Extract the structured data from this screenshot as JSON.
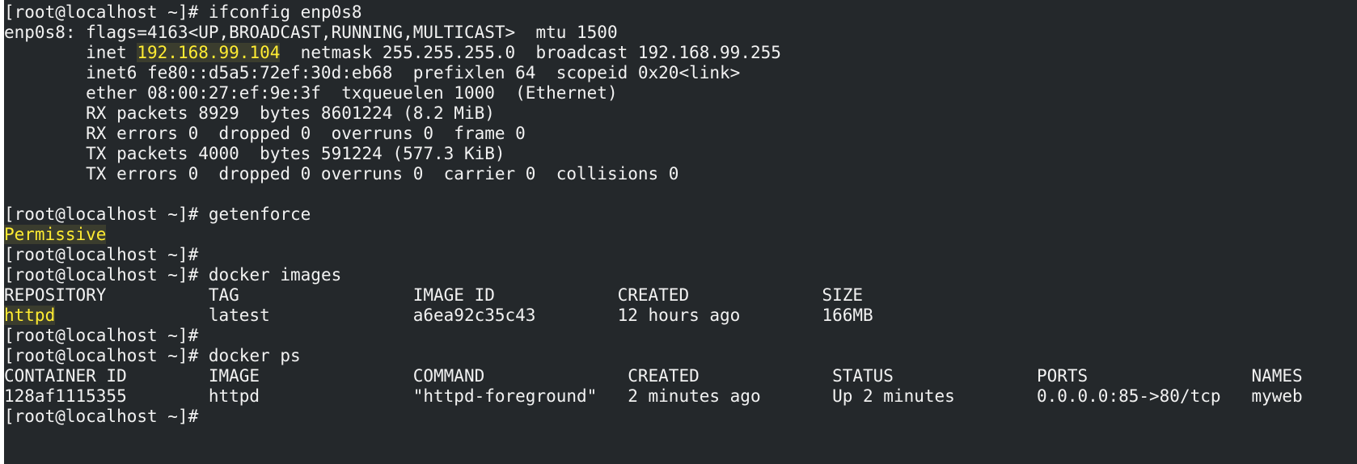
{
  "colors": {
    "background": "#24282b",
    "foreground": "#f2f2f2",
    "highlight": "#ffec32"
  },
  "terminal": {
    "lines": [
      {
        "kind": "prompt",
        "prompt": "[root@localhost ~]# ",
        "command": "ifconfig enp0s8"
      },
      {
        "kind": "text",
        "text": "enp0s8: flags=4163<UP,BROADCAST,RUNNING,MULTICAST>  mtu 1500"
      },
      {
        "kind": "inet",
        "prefix": "        inet ",
        "ip": "192.168.99.104",
        "suffix": "  netmask 255.255.255.0  broadcast 192.168.99.255"
      },
      {
        "kind": "text",
        "text": "        inet6 fe80::d5a5:72ef:30d:eb68  prefixlen 64  scopeid 0x20<link>"
      },
      {
        "kind": "text",
        "text": "        ether 08:00:27:ef:9e:3f  txqueuelen 1000  (Ethernet)"
      },
      {
        "kind": "text",
        "text": "        RX packets 8929  bytes 8601224 (8.2 MiB)"
      },
      {
        "kind": "text",
        "text": "        RX errors 0  dropped 0  overruns 0  frame 0"
      },
      {
        "kind": "text",
        "text": "        TX packets 4000  bytes 591224 (577.3 KiB)"
      },
      {
        "kind": "text",
        "text": "        TX errors 0  dropped 0 overruns 0  carrier 0  collisions 0"
      },
      {
        "kind": "blank",
        "text": ""
      },
      {
        "kind": "prompt",
        "prompt": "[root@localhost ~]# ",
        "command": "getenforce"
      },
      {
        "kind": "highlight",
        "text": "Permissive"
      },
      {
        "kind": "prompt",
        "prompt": "[root@localhost ~]# ",
        "command": ""
      },
      {
        "kind": "prompt",
        "prompt": "[root@localhost ~]# ",
        "command": "docker images"
      },
      {
        "kind": "text",
        "text": "REPOSITORY          TAG                 IMAGE ID            CREATED             SIZE"
      },
      {
        "kind": "image-row",
        "repo": "httpd",
        "rest": "               latest              a6ea92c35c43        12 hours ago        166MB"
      },
      {
        "kind": "prompt",
        "prompt": "[root@localhost ~]# ",
        "command": ""
      },
      {
        "kind": "prompt",
        "prompt": "[root@localhost ~]# ",
        "command": "docker ps"
      },
      {
        "kind": "text",
        "text": "CONTAINER ID        IMAGE               COMMAND              CREATED             STATUS              PORTS                NAMES"
      },
      {
        "kind": "text",
        "text": "128af1115355        httpd               \"httpd-foreground\"   2 minutes ago       Up 2 minutes        0.0.0.0:85->80/tcp   myweb"
      },
      {
        "kind": "prompt",
        "prompt": "[root@localhost ~]# ",
        "command": ""
      }
    ]
  }
}
